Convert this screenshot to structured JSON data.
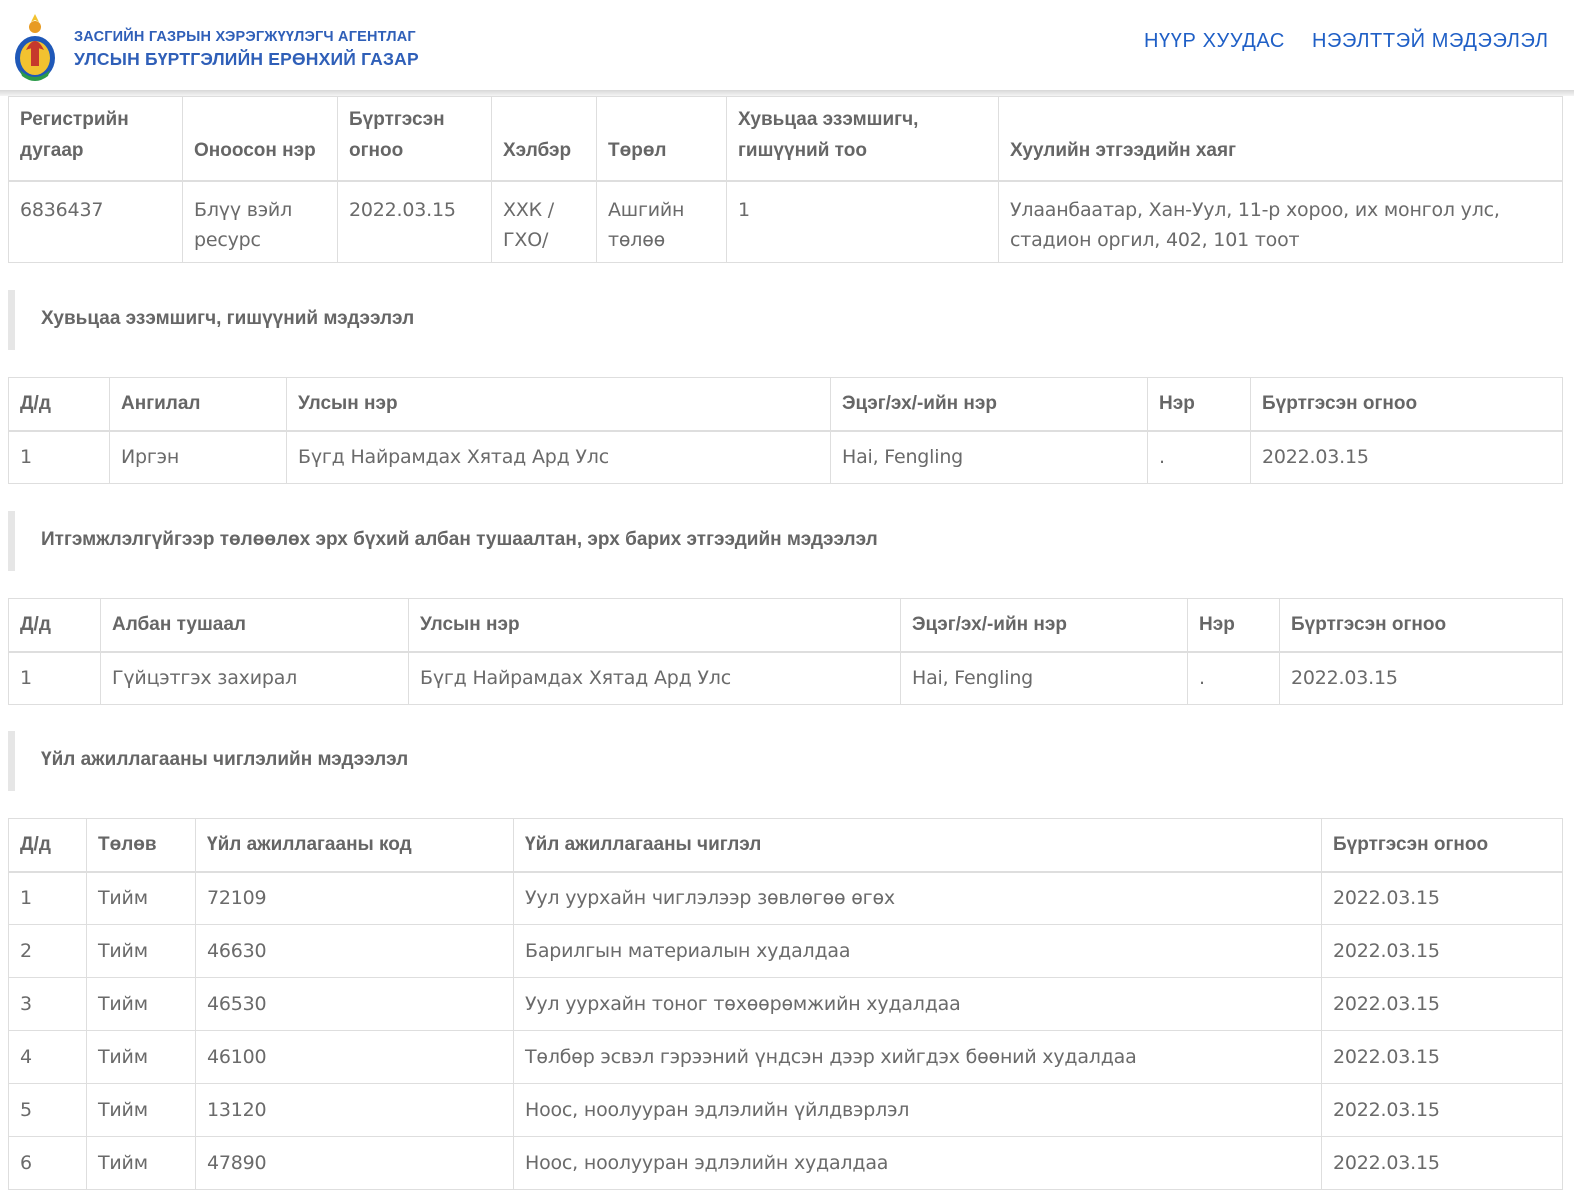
{
  "header": {
    "agency_line1": "ЗАСГИЙН ГАЗРЫН ХЭРЭГЖҮҮЛЭГЧ АГЕНТЛАГ",
    "agency_line2": "УЛСЫН БҮРТГЭЛИЙН ЕРӨНХИЙ ГАЗАР",
    "nav_home": "НҮҮР ХУУДАС",
    "nav_public_info": "НЭЭЛТТЭЙ МЭДЭЭЛЭЛ",
    "brand_color": "#2f5fb8",
    "logo_icon": "coat-of-arms-icon"
  },
  "entity": {
    "headers": [
      "Регистрийн дугаар",
      "Оноосон нэр",
      "Бүртгэсэн огноо",
      "Хэлбэр",
      "Төрөл",
      "Хувьцаа эзэмшигч, гишүүний тоо",
      "Хуулийн этгээдийн хаяг"
    ],
    "row": [
      "6836437",
      "Блүү вэйл ресурс",
      "2022.03.15",
      "ХХК / ГХО/",
      "Ашгийн төлөө",
      "1",
      "Улаанбаатар, Хан-Уул, 11-р хороо, их монгол улс, стадион оргил, 402, 101 тоот"
    ]
  },
  "shareholders": {
    "title": "Хувьцаа эзэмшигч, гишүүний мэдээлэл",
    "headers": [
      "Д/д",
      "Ангилал",
      "Улсын нэр",
      "Эцэг/эх/-ийн нэр",
      "Нэр",
      "Бүртгэсэн огноо"
    ],
    "rows": [
      [
        "1",
        "Иргэн",
        "Бүгд Найрамдах Хятад Ард Улс",
        "Hai, Fengling",
        ".",
        "2022.03.15"
      ]
    ]
  },
  "officials": {
    "title": "Итгэмжлэлгүйгээр төлөөлөх эрх бүхий албан тушаалтан, эрх барих этгээдийн мэдээлэл",
    "headers": [
      "Д/д",
      "Албан тушаал",
      "Улсын нэр",
      "Эцэг/эх/-ийн нэр",
      "Нэр",
      "Бүртгэсэн огноо"
    ],
    "rows": [
      [
        "1",
        "Гүйцэтгэх захирал",
        "Бүгд Найрамдах Хятад Ард Улс",
        "Hai, Fengling",
        ".",
        "2022.03.15"
      ]
    ]
  },
  "activities": {
    "title": "Үйл ажиллагааны чиглэлийн мэдээлэл",
    "headers": [
      "Д/д",
      "Төлөв",
      "Үйл ажиллагааны код",
      "Үйл ажиллагааны чиглэл",
      "Бүртгэсэн огноо"
    ],
    "rows": [
      [
        "1",
        "Тийм",
        "72109",
        "Уул уурхайн чиглэлээр зөвлөгөө өгөх",
        "2022.03.15"
      ],
      [
        "2",
        "Тийм",
        "46630",
        "Барилгын материалын худалдаа",
        "2022.03.15"
      ],
      [
        "3",
        "Тийм",
        "46530",
        "Уул уурхайн тоног төхөөрөмжийн худалдаа",
        "2022.03.15"
      ],
      [
        "4",
        "Тийм",
        "46100",
        "Төлбөр эсвэл гэрээний үндсэн дээр хийгдэх бөөний худалдаа",
        "2022.03.15"
      ],
      [
        "5",
        "Тийм",
        "13120",
        "Ноос, ноолууран эдлэлийн үйлдвэрлэл",
        "2022.03.15"
      ],
      [
        "6",
        "Тийм",
        "47890",
        "Ноос, ноолууран эдлэлийн худалдаа",
        "2022.03.15"
      ]
    ]
  }
}
